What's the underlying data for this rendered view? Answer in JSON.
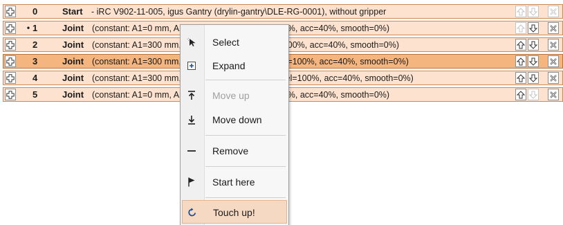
{
  "rows": [
    {
      "bullet": "",
      "index": "0",
      "command": "Start",
      "description": "- iRC V902-11-005, igus Gantry (drylin-gantry\\DLE-RG-0001), without gripper"
    },
    {
      "bullet": "•",
      "index": "1",
      "command": "Joint",
      "description": "(constant: A1=0 mm, A2=0 mm, A3=0 mm, vel=100%, acc=40%, smooth=0%)"
    },
    {
      "bullet": "",
      "index": "2",
      "command": "Joint",
      "description": "(constant: A1=300 mm, A2=0 mm, A3=0 mm, vel=100%, acc=40%, smooth=0%)"
    },
    {
      "bullet": "",
      "index": "3",
      "command": "Joint",
      "description": "(constant: A1=300 mm, A2=300 mm, A3=0 mm, vel=100%, acc=40%, smooth=0%)"
    },
    {
      "bullet": "",
      "index": "4",
      "command": "Joint",
      "description": "(constant: A1=300 mm, A2=300 mm, A3=60 mm, vel=100%, acc=40%, smooth=0%)"
    },
    {
      "bullet": "",
      "index": "5",
      "command": "Joint",
      "description": "(constant: A1=0 mm, A2=0 mm, A3=0 mm, vel=100%, acc=40%, smooth=0%)"
    }
  ],
  "context_menu": {
    "items": [
      {
        "label": "Select",
        "icon": "cursor-select-icon",
        "enabled": true
      },
      {
        "label": "Expand",
        "icon": "expand-plus-icon",
        "enabled": true
      },
      {
        "label": "Move up",
        "icon": "move-up-icon",
        "enabled": false
      },
      {
        "label": "Move down",
        "icon": "move-down-icon",
        "enabled": true
      },
      {
        "label": "Remove",
        "icon": "remove-dash-icon",
        "enabled": true
      },
      {
        "label": "Start here",
        "icon": "flag-icon",
        "enabled": true
      },
      {
        "label": "Touch up!",
        "icon": "refresh-icon",
        "enabled": true
      }
    ]
  },
  "colors": {
    "row_bg": "#fde3cf",
    "row_selected_bg": "#f5b57f",
    "row_border": "#c98a58",
    "menu_highlight": "#f6d9c2",
    "arrow_blue": "#3c6fb5"
  }
}
